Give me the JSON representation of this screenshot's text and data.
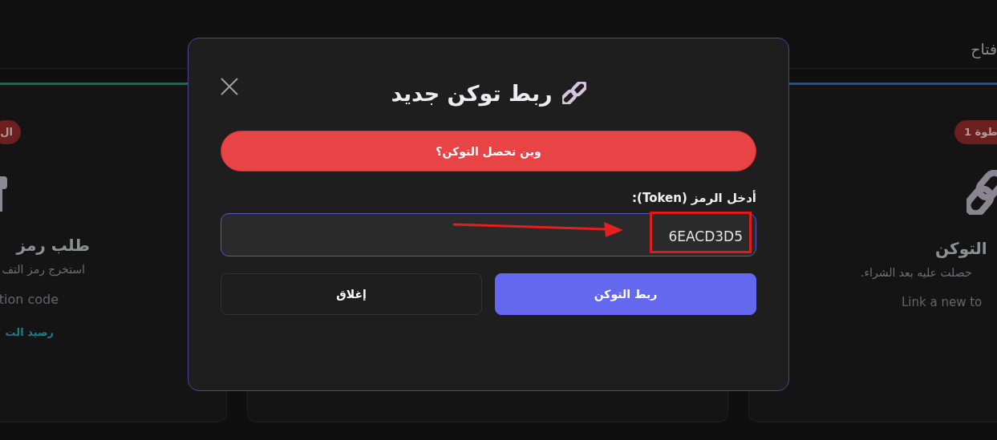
{
  "background": {
    "tab_label": "فتاح",
    "cards": [
      {
        "kind": "cut-right",
        "color": "#1f4f96",
        "badge": "طوة 1",
        "title": "التوكن",
        "description": "حصلت عليه بعد الشراء.",
        "english": "Link a new to"
      },
      {
        "kind": "covered"
      },
      {
        "kind": "cut-left",
        "color": "#157049",
        "badge": "ال",
        "title": "طلب رمز",
        "description": "استخرج رمز التف",
        "english": "tion code",
        "link": "رصيد الت"
      }
    ]
  },
  "modal": {
    "title": "ربط توكن جديد",
    "help_button": "وين تحصل التوكن؟",
    "token_label": "أدخل الرمز (Token):",
    "token_value": "6EACD3D5",
    "highlighted": true,
    "buttons": [
      {
        "kind": "primary",
        "label": "ربط التوكن"
      },
      {
        "kind": "secondary",
        "label": "إغلاق"
      }
    ]
  }
}
